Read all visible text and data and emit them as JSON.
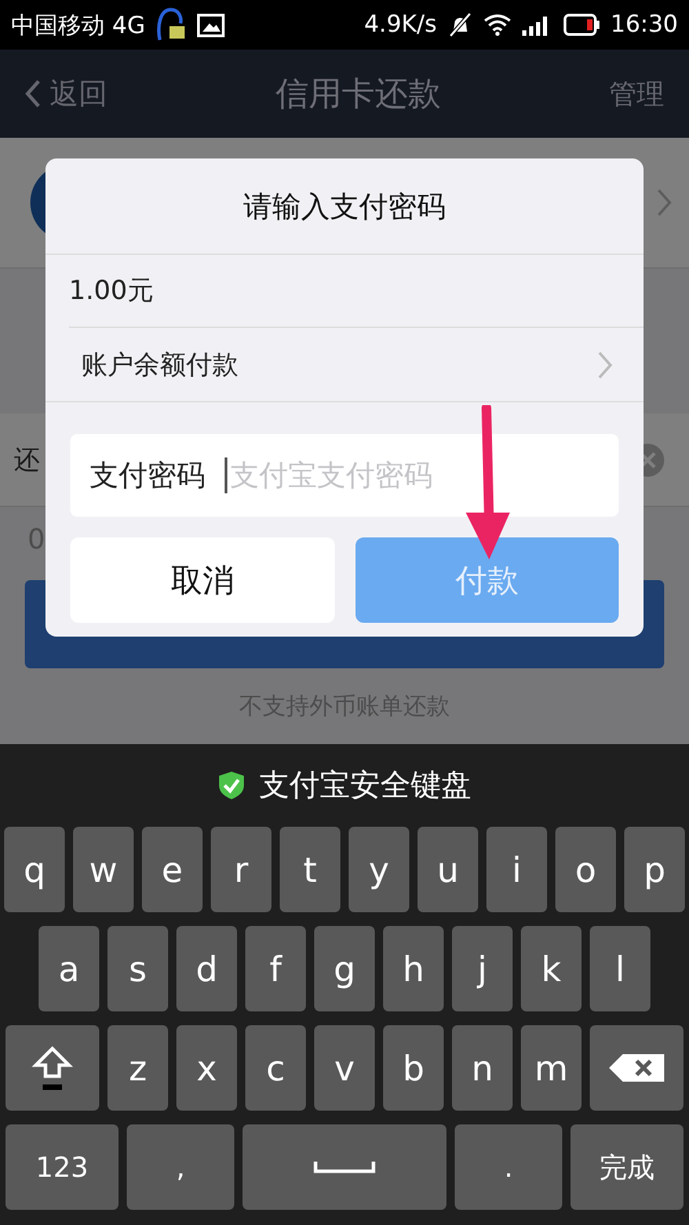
{
  "status_bar": {
    "carrier": "中国移动 4G",
    "speed": "4.9K/s",
    "time": "16:30"
  },
  "nav_bar": {
    "back": "返回",
    "title": "信用卡还款",
    "action": "管理"
  },
  "background": {
    "label_fragment": "还",
    "value_fragment": "0",
    "note": "不支持外币账单还款"
  },
  "dialog": {
    "title": "请输入支付密码",
    "amount": "1.00元",
    "method": "账户余额付款",
    "password_field": {
      "label": "支付密码",
      "placeholder": "支付宝支付密码"
    },
    "buttons": [
      {
        "label": "取消",
        "kind": "cancel"
      },
      {
        "label": "付款",
        "kind": "confirm",
        "disabled": true
      }
    ]
  },
  "keyboard": {
    "title": "支付宝安全键盘",
    "rows": [
      [
        {
          "kind": "letter",
          "label": "q"
        },
        {
          "kind": "letter",
          "label": "w"
        },
        {
          "kind": "letter",
          "label": "e"
        },
        {
          "kind": "letter",
          "label": "r"
        },
        {
          "kind": "letter",
          "label": "t"
        },
        {
          "kind": "letter",
          "label": "y"
        },
        {
          "kind": "letter",
          "label": "u"
        },
        {
          "kind": "letter",
          "label": "i"
        },
        {
          "kind": "letter",
          "label": "o"
        },
        {
          "kind": "letter",
          "label": "p"
        }
      ],
      [
        {
          "kind": "letter",
          "label": "a"
        },
        {
          "kind": "letter",
          "label": "s"
        },
        {
          "kind": "letter",
          "label": "d"
        },
        {
          "kind": "letter",
          "label": "f"
        },
        {
          "kind": "letter",
          "label": "g"
        },
        {
          "kind": "letter",
          "label": "h"
        },
        {
          "kind": "letter",
          "label": "j"
        },
        {
          "kind": "letter",
          "label": "k"
        },
        {
          "kind": "letter",
          "label": "l"
        }
      ],
      [
        {
          "kind": "shift"
        },
        {
          "kind": "letter",
          "label": "z"
        },
        {
          "kind": "letter",
          "label": "x"
        },
        {
          "kind": "letter",
          "label": "c"
        },
        {
          "kind": "letter",
          "label": "v"
        },
        {
          "kind": "letter",
          "label": "b"
        },
        {
          "kind": "letter",
          "label": "n"
        },
        {
          "kind": "letter",
          "label": "m"
        },
        {
          "kind": "backspace"
        }
      ],
      [
        {
          "kind": "mode",
          "label": "123"
        },
        {
          "kind": "punct",
          "label": ","
        },
        {
          "kind": "space"
        },
        {
          "kind": "punct",
          "label": "."
        },
        {
          "kind": "done",
          "label": "完成"
        }
      ]
    ]
  }
}
